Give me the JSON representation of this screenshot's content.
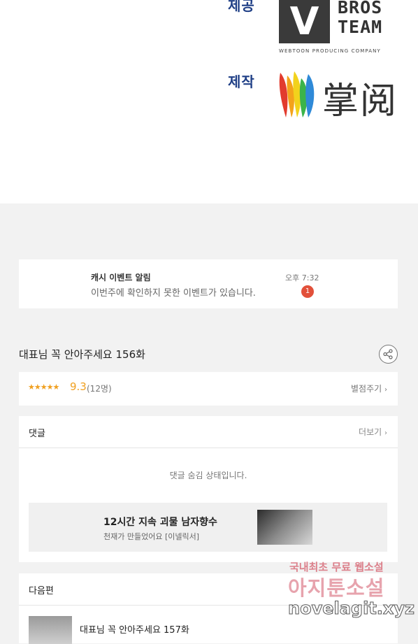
{
  "credits": {
    "provided_label": "제공",
    "provider_logo_text": [
      "V",
      "BROS",
      "TEAM"
    ],
    "provider_tagline": "WEBTOON PRODUCING COMPANY",
    "produced_label": "제작",
    "producer_logo_text": "掌阅"
  },
  "notification": {
    "title": "캐시 이벤트 알림",
    "message": "이번주에 확인하지 못한 이벤트가 있습니다.",
    "time": "오후 7:32",
    "badge": "1"
  },
  "episode": {
    "title": "대표님 꼭 안아주세요 156화",
    "share_icon": "share-icon"
  },
  "rating": {
    "stars_fraction": 0.93,
    "score": "9.3",
    "count": "(12명)",
    "rate_button": "별점주기"
  },
  "comments": {
    "label": "댓글",
    "more": "더보기",
    "hidden_notice": "댓글 숨김 상태입니다."
  },
  "ad": {
    "title": "12시간 지속 괴물 남자향수",
    "subtitle": "천재가 만들었어요 [이넬릭서]"
  },
  "next_episode": {
    "label": "다음편",
    "title": "대표님 꼭 안아주세요 157화"
  },
  "watermark": {
    "line1": "국내최초 무료 웹소설",
    "line2": "아지툰소설",
    "line3": "novelagit.xyz"
  },
  "colors": {
    "accent_star": "#f0a020",
    "badge": "#e2503a",
    "credit_label": "#1f3f86"
  }
}
